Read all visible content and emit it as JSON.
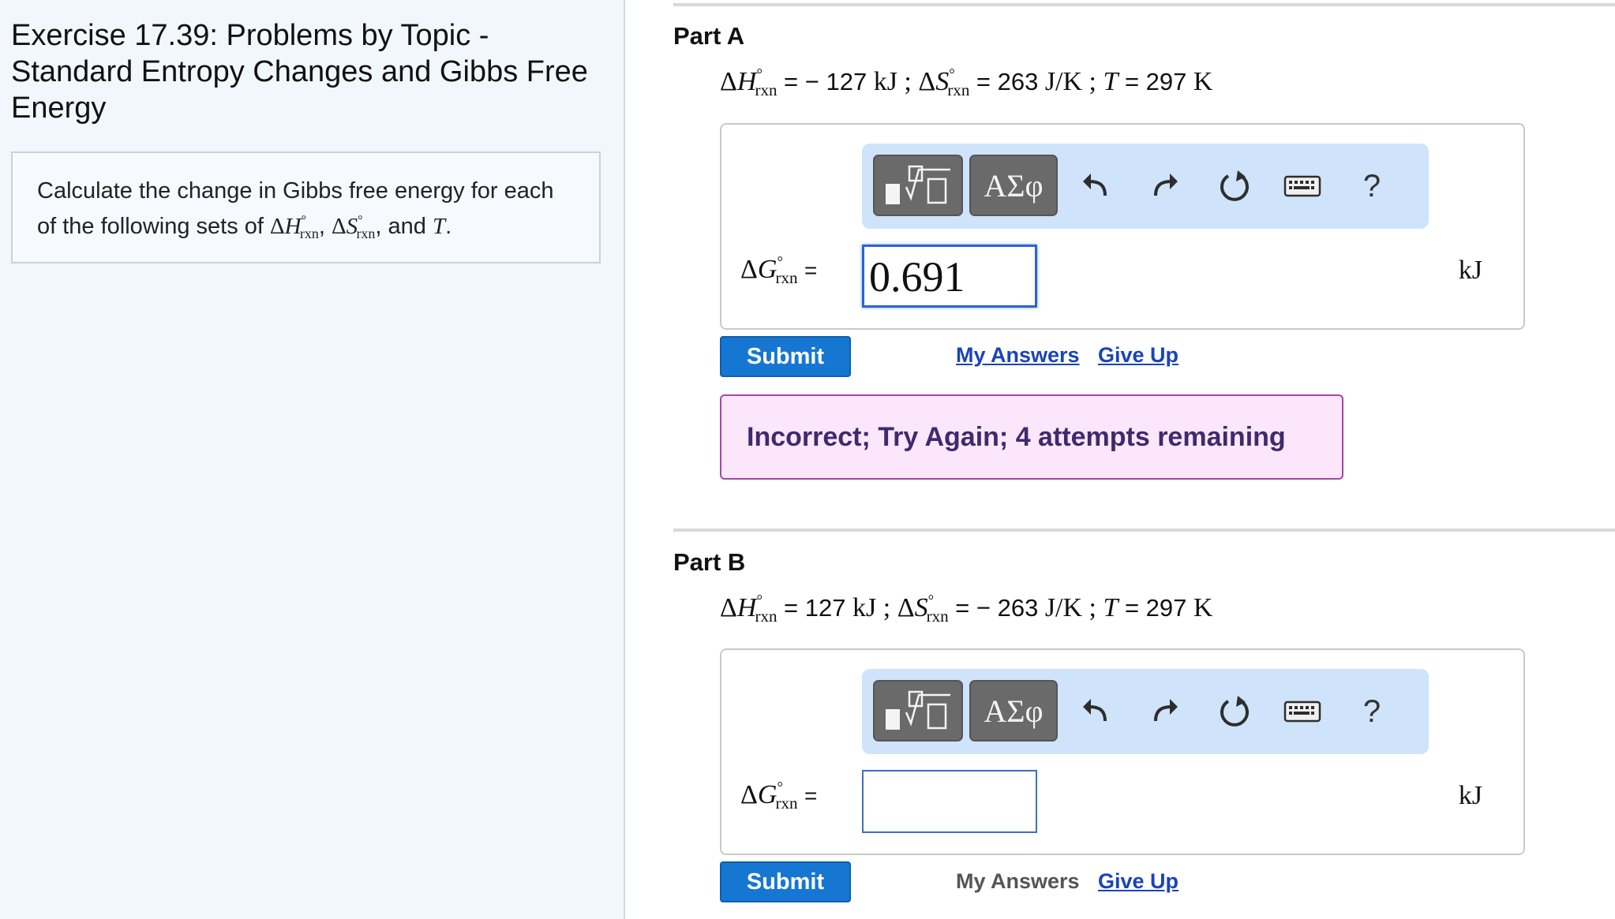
{
  "exercise": {
    "title": "Exercise 17.39: Problems by Topic - Standard Entropy Changes and Gibbs Free Energy",
    "instructions_text": "Calculate the change in Gibbs free energy for each of the following sets of",
    "instructions_and": ", and",
    "instructions_end": "."
  },
  "symbols": {
    "delta": "Δ",
    "H": "H",
    "S": "S",
    "G": "G",
    "T": "T",
    "rxn": "rxn",
    "degree": "°"
  },
  "toolbar": {
    "greek_label": "ΑΣφ",
    "help_label": "?"
  },
  "parts": [
    {
      "title": "Part A",
      "given": {
        "dH": "= − 127",
        "dH_unit": "kJ ;",
        "dS": "= 263",
        "dS_unit": "J/K ;",
        "T": "= 297",
        "T_unit": "K"
      },
      "answer_equals": "=",
      "answer_value": "0.691",
      "answer_unit": "kJ",
      "submit_label": "Submit",
      "my_answers_label": "My Answers",
      "give_up_label": "Give Up",
      "feedback": "Incorrect; Try Again; 4 attempts remaining"
    },
    {
      "title": "Part B",
      "given": {
        "dH": "= 127",
        "dH_unit": "kJ ;",
        "dS": "= − 263",
        "dS_unit": "J/K ;",
        "T": "= 297",
        "T_unit": "K"
      },
      "answer_equals": "=",
      "answer_value": "",
      "answer_unit": "kJ",
      "submit_label": "Submit",
      "my_answers_label": "My Answers",
      "give_up_label": "Give Up"
    }
  ]
}
